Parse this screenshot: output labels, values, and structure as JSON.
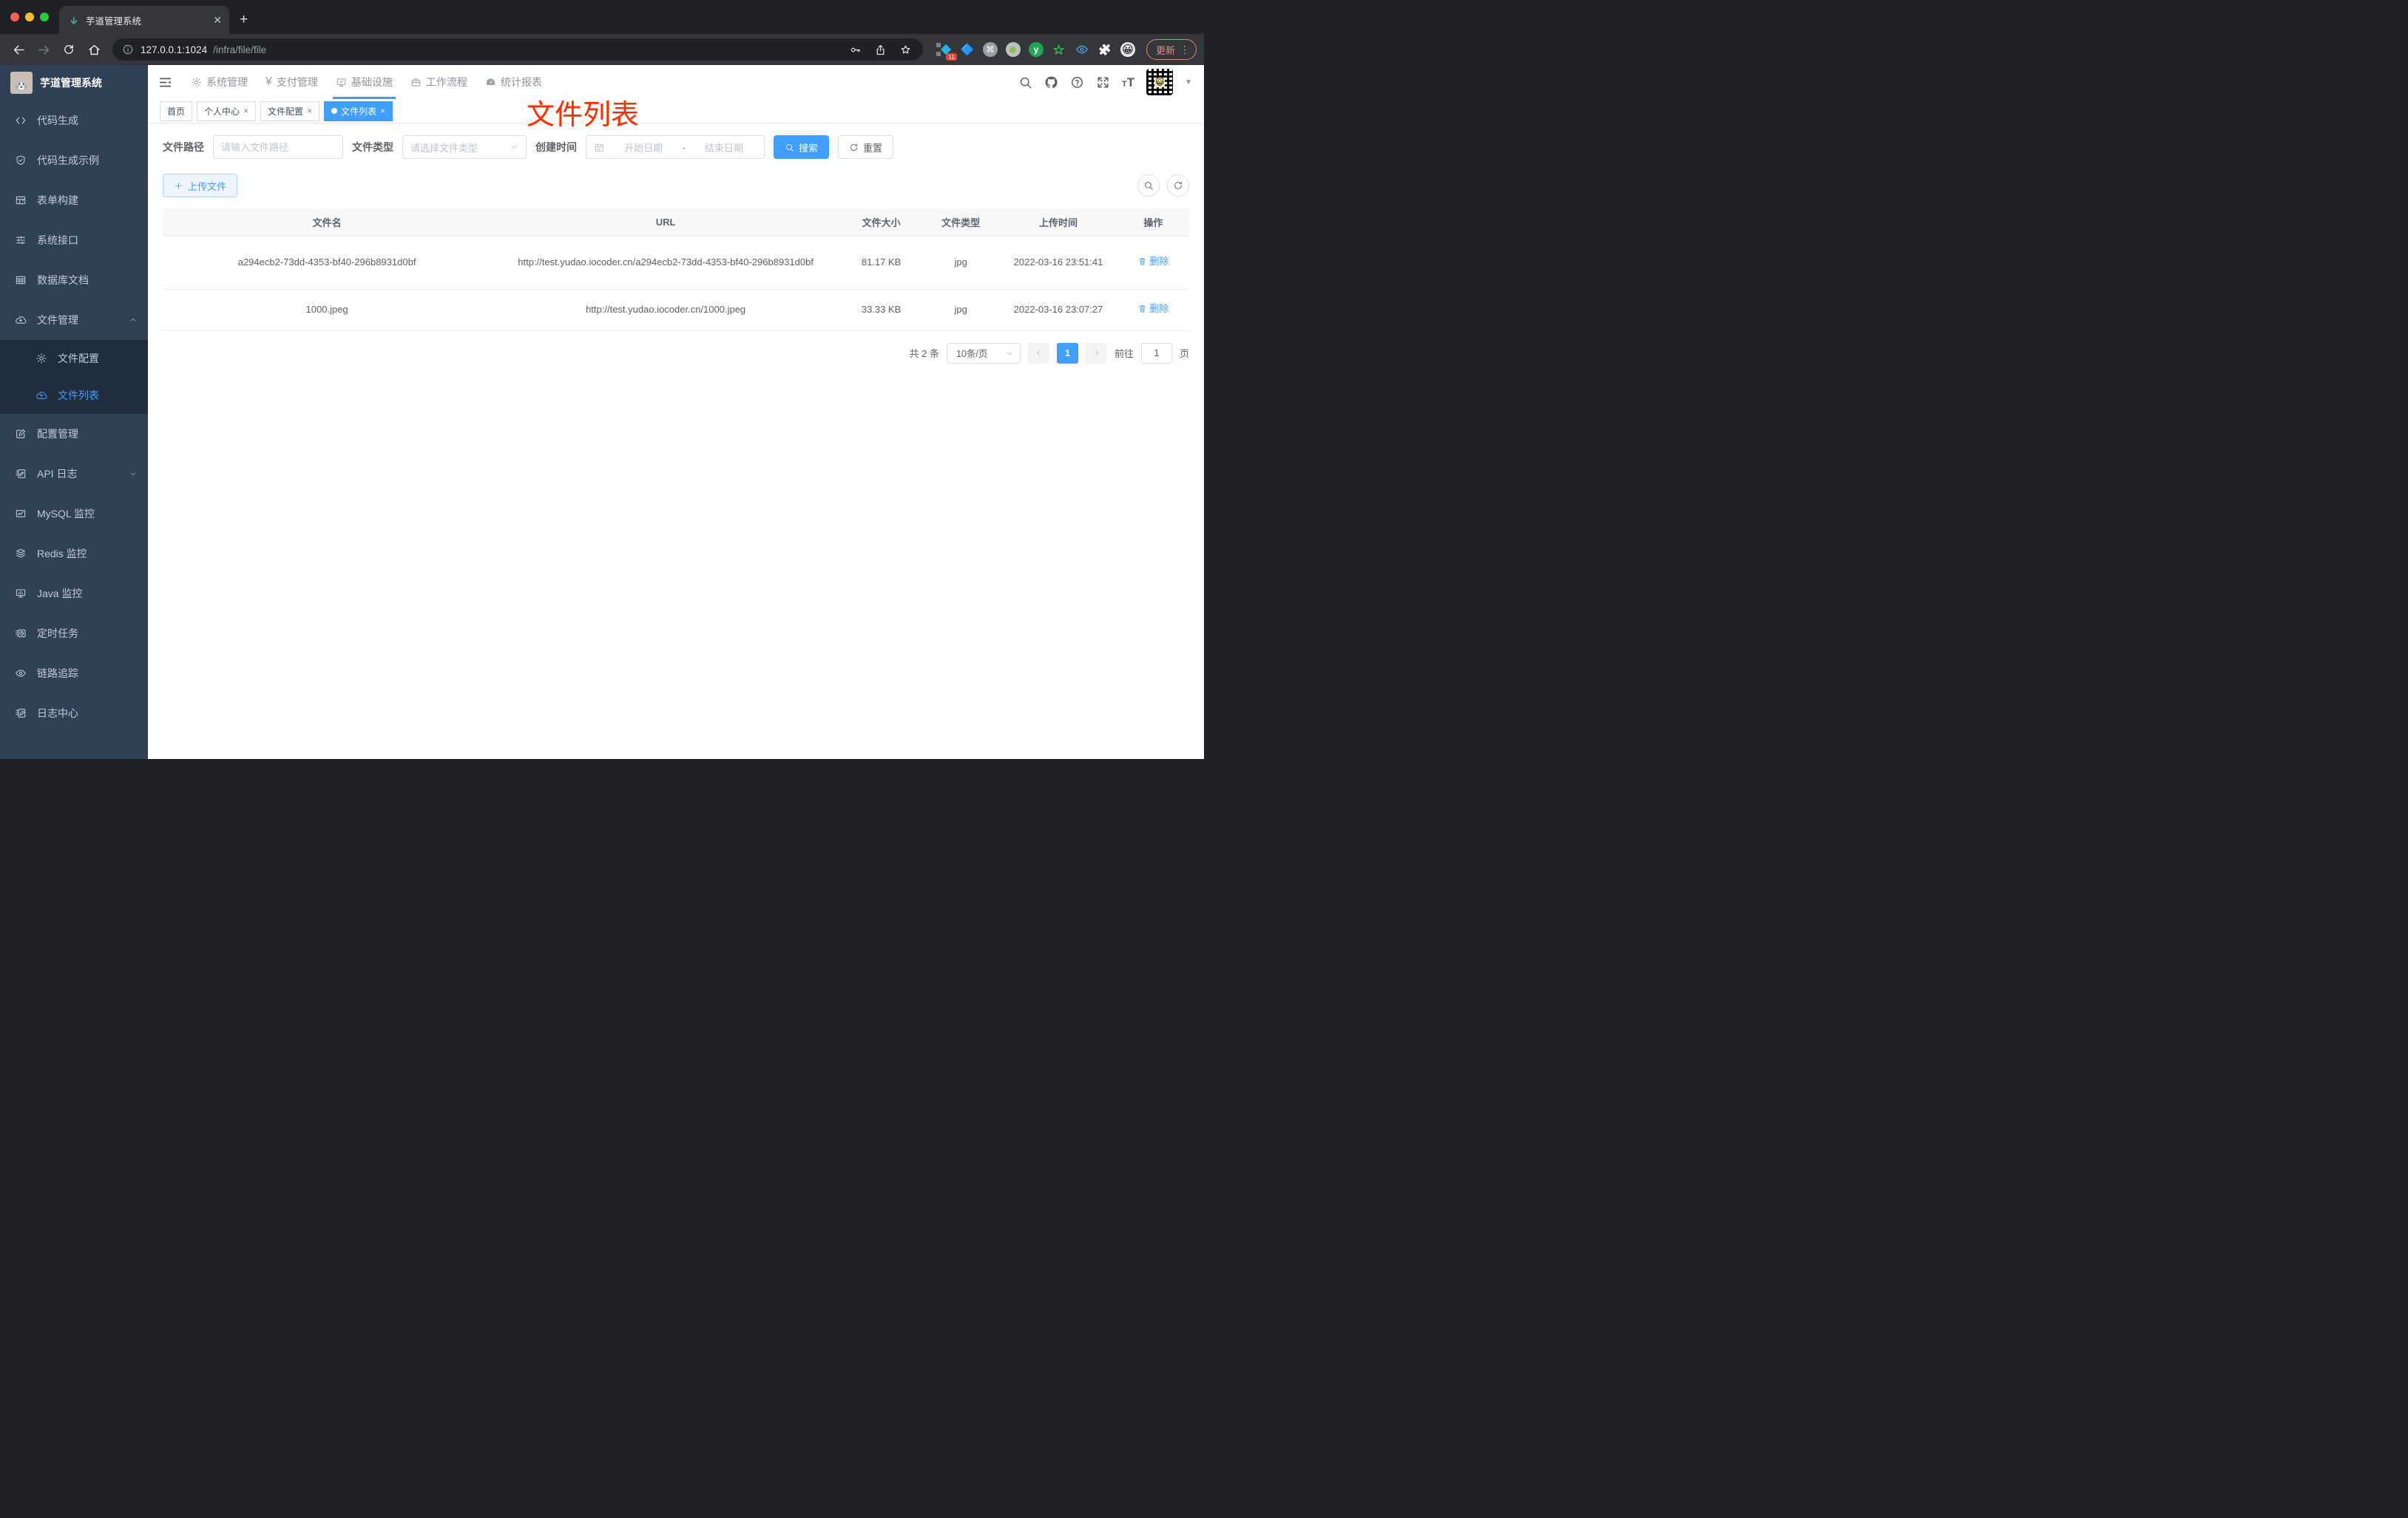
{
  "browser": {
    "tab_title": "芋道管理系统",
    "new_tab_label": "+",
    "url_host": "127.0.0.1:1024",
    "url_path": "/infra/file/file",
    "extension_badge": "11",
    "extension_y_label": "y",
    "update_label": "更新"
  },
  "sidebar": {
    "title": "芋道管理系统",
    "items": [
      {
        "label": "代码生成",
        "icon": "code"
      },
      {
        "label": "代码生成示例",
        "icon": "shield"
      },
      {
        "label": "表单构建",
        "icon": "form"
      },
      {
        "label": "系统接口",
        "icon": "sliders"
      },
      {
        "label": "数据库文档",
        "icon": "grid"
      },
      {
        "label": "文件管理",
        "icon": "cloud-down",
        "expanded": true,
        "children": [
          {
            "label": "文件配置",
            "icon": "gear",
            "active": false
          },
          {
            "label": "文件列表",
            "icon": "cloud-up",
            "active": true
          }
        ]
      },
      {
        "label": "配置管理",
        "icon": "edit"
      },
      {
        "label": "API 日志",
        "icon": "doc-edit",
        "has_children": true
      },
      {
        "label": "MySQL 监控",
        "icon": "chart-mon"
      },
      {
        "label": "Redis 监控",
        "icon": "layers"
      },
      {
        "label": "Java 监控",
        "icon": "monitor"
      },
      {
        "label": "定时任务",
        "icon": "timer"
      },
      {
        "label": "链路追踪",
        "icon": "eye"
      },
      {
        "label": "日志中心",
        "icon": "log-edit"
      }
    ]
  },
  "header": {
    "nav": [
      {
        "label": "系统管理",
        "icon": "gear",
        "active": false
      },
      {
        "label": "支付管理",
        "icon": "yen",
        "active": false
      },
      {
        "label": "基础设施",
        "icon": "infra",
        "active": true
      },
      {
        "label": "工作流程",
        "icon": "briefcase",
        "active": false
      },
      {
        "label": "统计报表",
        "icon": "dashboard",
        "active": false
      }
    ]
  },
  "tags": [
    {
      "label": "首页",
      "closable": false,
      "active": false
    },
    {
      "label": "个人中心",
      "closable": true,
      "active": false
    },
    {
      "label": "文件配置",
      "closable": true,
      "active": false
    },
    {
      "label": "文件列表",
      "closable": true,
      "active": true
    }
  ],
  "annotation": "文件列表",
  "filters": {
    "path_label": "文件路径",
    "path_placeholder": "请输入文件路径",
    "type_label": "文件类型",
    "type_placeholder": "请选择文件类型",
    "date_label": "创建时间",
    "date_start": "开始日期",
    "date_sep": "-",
    "date_end": "结束日期",
    "search_label": "搜索",
    "reset_label": "重置"
  },
  "toolbar": {
    "upload_label": "上传文件"
  },
  "table": {
    "headers": [
      "文件名",
      "URL",
      "文件大小",
      "文件类型",
      "上传时间",
      "操作"
    ],
    "delete_label": "删除",
    "rows": [
      {
        "name": "a294ecb2-73dd-4353-bf40-296b8931d0bf",
        "url": "http://test.yudao.iocoder.cn/a294ecb2-73dd-4353-bf40-296b8931d0bf",
        "size": "81.17 KB",
        "type": "jpg",
        "time": "2022-03-16 23:51:41"
      },
      {
        "name": "1000.jpeg",
        "url": "http://test.yudao.iocoder.cn/1000.jpeg",
        "size": "33.33 KB",
        "type": "jpg",
        "time": "2022-03-16 23:07:27"
      }
    ]
  },
  "pagination": {
    "total_label": "共 2 条",
    "page_size_label": "10条/页",
    "current_page": "1",
    "goto_label": "前往",
    "goto_value": "1",
    "page_suffix": "页"
  },
  "colors": {
    "accent": "#409eff",
    "annotation_red": "#ff2d00",
    "sidebar_bg": "#304156",
    "submenu_bg": "#1f2d3d"
  }
}
